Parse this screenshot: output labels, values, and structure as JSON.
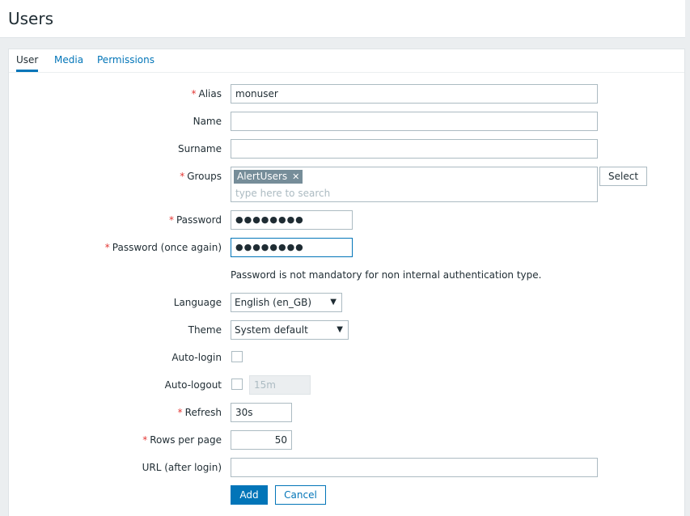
{
  "page": {
    "title": "Users"
  },
  "tabs": [
    {
      "label": "User",
      "active": true
    },
    {
      "label": "Media",
      "active": false
    },
    {
      "label": "Permissions",
      "active": false
    }
  ],
  "form": {
    "alias": {
      "label": "Alias",
      "required": true,
      "value": "monuser"
    },
    "name": {
      "label": "Name",
      "required": false,
      "value": ""
    },
    "surname": {
      "label": "Surname",
      "required": false,
      "value": ""
    },
    "groups": {
      "label": "Groups",
      "required": true,
      "selected": [
        "AlertUsers"
      ],
      "placeholder": "type here to search",
      "select_button": "Select"
    },
    "password": {
      "label": "Password",
      "required": true,
      "value": "●●●●●●●●"
    },
    "password_again": {
      "label": "Password (once again)",
      "required": true,
      "value": "●●●●●●●●"
    },
    "password_hint": "Password is not mandatory for non internal authentication type.",
    "language": {
      "label": "Language",
      "value": "English (en_GB)"
    },
    "theme": {
      "label": "Theme",
      "value": "System default"
    },
    "autologin": {
      "label": "Auto-login",
      "checked": false
    },
    "autologout": {
      "label": "Auto-logout",
      "checked": false,
      "value": "15m"
    },
    "refresh": {
      "label": "Refresh",
      "required": true,
      "value": "30s"
    },
    "rows_per_page": {
      "label": "Rows per page",
      "required": true,
      "value": "50"
    },
    "url": {
      "label": "URL (after login)",
      "value": ""
    },
    "buttons": {
      "add": "Add",
      "cancel": "Cancel"
    }
  },
  "colors": {
    "accent": "#0275b8",
    "required": "#e33734",
    "chip": "#768d99"
  }
}
